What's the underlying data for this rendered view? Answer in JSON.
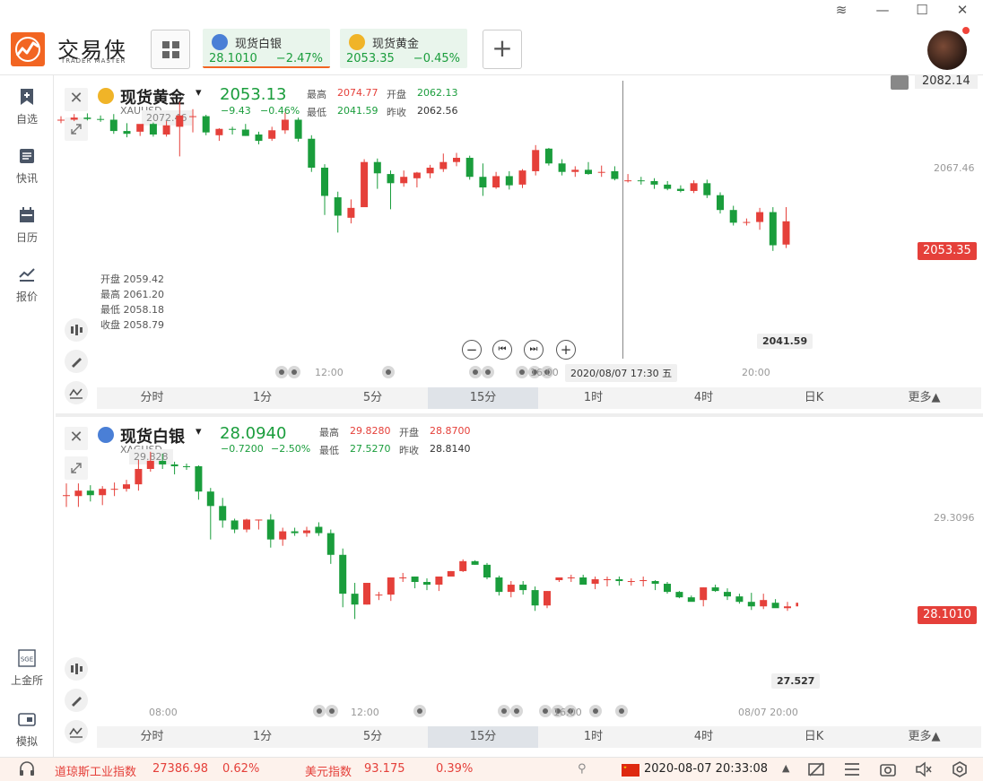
{
  "app": {
    "logo_text": "交易侠",
    "logo_sub": "TRADER MASTER"
  },
  "header_tiles": [
    {
      "name": "现货白银",
      "price": "28.1010",
      "change": "−2.47%",
      "coin_color": "#4a7fd6"
    },
    {
      "name": "现货黄金",
      "price": "2053.35",
      "change": "−0.45%",
      "coin_color": "#f0b428"
    }
  ],
  "sidebar": {
    "items": [
      {
        "label": "自选",
        "icon": "bookmark-plus-icon"
      },
      {
        "label": "快讯",
        "icon": "news-list-icon"
      },
      {
        "label": "日历",
        "icon": "calendar-icon"
      },
      {
        "label": "报价",
        "icon": "quote-chart-icon"
      }
    ],
    "bottom_items": [
      {
        "label": "上金所",
        "icon": "sge-icon",
        "icon_text": "SGE"
      },
      {
        "label": "模拟",
        "icon": "wallet-icon"
      }
    ]
  },
  "gold": {
    "title": "现货黄金",
    "symbol": "XAUUSD",
    "price": "2053.13",
    "change": "−9.43",
    "change_pct": "−0.46%",
    "labels": {
      "high": "最高",
      "open": "开盘",
      "low": "最低",
      "prev": "昨收"
    },
    "high": "2074.77",
    "open": "2062.13",
    "low": "2041.59",
    "prev_close": "2062.56",
    "hover_ohlc": {
      "open": "开盘 2059.42",
      "high": "最高 2061.20",
      "low": "最低 2058.18",
      "close": "收盘 2058.79"
    },
    "max_callout": "2072.46",
    "min_callout": "2041.59",
    "axis_top": "2082.14",
    "axis_mid": "2067.46",
    "current_tag": "2053.35",
    "crosshair_label": "2020/08/07 17:30 五",
    "time_labels": [
      "12:00",
      "16:00",
      "20:00"
    ],
    "zoom_controls": [
      "−",
      "⏮",
      "⏭",
      "+"
    ]
  },
  "silver": {
    "title": "现货白银",
    "symbol": "XAGUSD",
    "price": "28.0940",
    "change": "−0.7200",
    "change_pct": "−2.50%",
    "high": "29.8280",
    "open": "28.8700",
    "low": "27.5270",
    "prev_close": "28.8140",
    "max_callout": "29.828",
    "min_callout": "27.527",
    "axis_mid": "29.3096",
    "current_tag": "28.1010",
    "time_labels": [
      "08:00",
      "12:00",
      "16:00",
      "08/07 20:00"
    ]
  },
  "timeframes": [
    "分时",
    "1分",
    "5分",
    "15分",
    "1时",
    "4时",
    "日K",
    "更多▲"
  ],
  "selected_timeframe": "15分",
  "statusbar": {
    "dow_label": "道琼斯工业指数",
    "dow_value": "27386.98",
    "dow_change": "0.62%",
    "usd_label": "美元指数",
    "usd_value": "93.175",
    "usd_change": "0.39%",
    "datetime": "2020-08-07 20:33:08"
  },
  "colors": {
    "up": "#e5403a",
    "down": "#1a9d3c",
    "accent": "#f26522"
  },
  "chart_data": [
    {
      "type": "candlestick",
      "title": "现货黄金",
      "x": [
        "08/07 ~10:00",
        "...",
        "08/07 ~21:00"
      ],
      "candles_ohlc_approx": [
        [
          2070.0,
          2070.5,
          2069.5,
          2070.0
        ],
        [
          2070.0,
          2070.8,
          2069.8,
          2070.3
        ],
        [
          2070.3,
          2070.9,
          2069.9,
          2070.1
        ],
        [
          2070.1,
          2070.6,
          2069.7,
          2070.0
        ],
        [
          2070.0,
          2070.8,
          2068.0,
          2068.4
        ],
        [
          2068.4,
          2069.5,
          2067.5,
          2068.0
        ],
        [
          2068.3,
          2068.8,
          2067.7,
          2069.4
        ],
        [
          2069.4,
          2069.6,
          2067.6,
          2067.9
        ],
        [
          2067.9,
          2069.8,
          2067.6,
          2069.2
        ],
        [
          2069.0,
          2072.5,
          2064.8,
          2070.6
        ],
        [
          2070.4,
          2071.5,
          2068.2,
          2070.5
        ],
        [
          2070.5,
          2070.7,
          2067.8,
          2068.2
        ],
        [
          2067.8,
          2068.8,
          2067.0,
          2068.7
        ],
        [
          2068.7,
          2069.0,
          2067.9,
          2068.6
        ],
        [
          2068.6,
          2069.4,
          2067.7,
          2067.7
        ],
        [
          2067.9,
          2068.3,
          2066.5,
          2067.0
        ],
        [
          2067.3,
          2069.0,
          2067.0,
          2068.5
        ],
        [
          2068.5,
          2071.0,
          2068.0,
          2070.0
        ],
        [
          2070.0,
          2070.3,
          2066.9,
          2067.3
        ],
        [
          2067.3,
          2067.8,
          2062.6,
          2063.2
        ],
        [
          2063.2,
          2063.7,
          2056.5,
          2059.2
        ],
        [
          2059.0,
          2059.8,
          2054.0,
          2056.4
        ],
        [
          2056.1,
          2058.7,
          2055.3,
          2057.5
        ],
        [
          2057.6,
          2064.4,
          2058.0,
          2064.0
        ],
        [
          2064.0,
          2064.5,
          2060.2,
          2062.4
        ],
        [
          2062.3,
          2062.8,
          2057.3,
          2061.0
        ],
        [
          2061.0,
          2062.8,
          2060.5,
          2061.9
        ],
        [
          2061.7,
          2062.6,
          2060.4,
          2062.5
        ],
        [
          2062.4,
          2063.6,
          2061.7,
          2063.2
        ],
        [
          2063.0,
          2065.2,
          2062.6,
          2064.0
        ],
        [
          2064.0,
          2065.3,
          2063.4,
          2064.6
        ],
        [
          2064.6,
          2064.9,
          2061.5,
          2061.9
        ],
        [
          2061.9,
          2063.8,
          2059.2,
          2060.4
        ],
        [
          2060.4,
          2062.6,
          2060.2,
          2062.0
        ],
        [
          2062.0,
          2062.7,
          2060.1,
          2060.7
        ],
        [
          2060.8,
          2063.0,
          2060.3,
          2062.8
        ],
        [
          2062.7,
          2066.4,
          2062.1,
          2065.7
        ],
        [
          2065.9,
          2066.0,
          2063.5,
          2063.8
        ],
        [
          2063.8,
          2064.4,
          2062.1,
          2062.6
        ],
        [
          2062.6,
          2063.4,
          2061.9,
          2062.9
        ],
        [
          2062.9,
          2064.0,
          2062.2,
          2062.3
        ],
        [
          2062.5,
          2063.5,
          2061.9,
          2062.6
        ],
        [
          2062.7,
          2063.4,
          2061.4,
          2061.6
        ],
        [
          2061.4,
          2062.3,
          2061.1,
          2061.4
        ],
        [
          2061.4,
          2061.9,
          2060.8,
          2061.3
        ],
        [
          2061.3,
          2061.7,
          2060.2,
          2060.8
        ],
        [
          2060.8,
          2061.3,
          2060.0,
          2060.2
        ],
        [
          2060.2,
          2060.7,
          2059.7,
          2059.9
        ],
        [
          2059.9,
          2061.4,
          2059.6,
          2061.0
        ],
        [
          2061.0,
          2061.5,
          2058.9,
          2059.3
        ],
        [
          2059.3,
          2059.7,
          2056.7,
          2057.2
        ],
        [
          2057.2,
          2057.8,
          2055.0,
          2055.4
        ],
        [
          2055.4,
          2056.0,
          2055.0,
          2055.5
        ],
        [
          2055.5,
          2057.5,
          2054.4,
          2056.9
        ],
        [
          2056.9,
          2057.6,
          2051.4,
          2052.2
        ],
        [
          2052.3,
          2057.6,
          2051.8,
          2055.6
        ]
      ],
      "ylim": [
        2041.59,
        2082.14
      ]
    },
    {
      "type": "candlestick",
      "title": "现货白银",
      "x": [
        "08/07 ~07:00",
        "...",
        "08/07 ~21:00"
      ],
      "candles_ohlc_approx": [
        [
          29.3,
          29.44,
          29.18,
          29.31
        ],
        [
          29.3,
          29.44,
          29.18,
          29.36
        ],
        [
          29.36,
          29.42,
          29.24,
          29.31
        ],
        [
          29.31,
          29.41,
          29.2,
          29.38
        ],
        [
          29.38,
          29.45,
          29.3,
          29.38
        ],
        [
          29.38,
          29.48,
          29.35,
          29.43
        ],
        [
          29.43,
          29.7,
          29.36,
          29.6
        ],
        [
          29.6,
          29.79,
          29.57,
          29.69
        ],
        [
          29.69,
          29.77,
          29.6,
          29.65
        ],
        [
          29.65,
          29.68,
          29.54,
          29.63
        ],
        [
          29.63,
          29.66,
          29.59,
          29.62
        ],
        [
          29.63,
          29.64,
          29.26,
          29.35
        ],
        [
          29.35,
          29.39,
          28.82,
          29.19
        ],
        [
          29.19,
          29.28,
          28.95,
          29.03
        ],
        [
          29.03,
          29.05,
          28.89,
          28.93
        ],
        [
          28.93,
          29.05,
          28.9,
          29.04
        ],
        [
          29.03,
          29.04,
          28.93,
          29.04
        ],
        [
          29.04,
          29.1,
          28.73,
          28.82
        ],
        [
          28.82,
          28.95,
          28.75,
          28.91
        ],
        [
          28.91,
          28.95,
          28.86,
          28.89
        ],
        [
          28.89,
          28.96,
          28.85,
          28.92
        ],
        [
          28.96,
          29.01,
          28.86,
          28.89
        ],
        [
          28.89,
          28.93,
          28.55,
          28.65
        ],
        [
          28.65,
          28.72,
          28.07,
          28.22
        ],
        [
          28.22,
          28.34,
          27.94,
          28.1
        ],
        [
          28.1,
          28.34,
          28.1,
          28.34
        ],
        [
          28.2,
          28.24,
          28.15,
          28.21
        ],
        [
          28.21,
          28.4,
          28.14,
          28.4
        ],
        [
          28.4,
          28.45,
          28.35,
          28.4
        ],
        [
          28.41,
          28.41,
          28.28,
          28.35
        ],
        [
          28.35,
          28.39,
          28.26,
          28.32
        ],
        [
          28.32,
          28.41,
          28.25,
          28.41
        ],
        [
          28.41,
          28.47,
          28.44,
          28.47
        ],
        [
          28.47,
          28.6,
          28.46,
          28.58
        ],
        [
          28.58,
          28.59,
          28.54,
          28.54
        ],
        [
          28.54,
          28.56,
          28.38,
          28.4
        ],
        [
          28.4,
          28.42,
          28.2,
          28.24
        ],
        [
          28.24,
          28.36,
          28.18,
          28.32
        ],
        [
          28.32,
          28.36,
          28.21,
          28.26
        ],
        [
          28.26,
          28.3,
          28.03,
          28.09
        ],
        [
          28.09,
          28.25,
          28.06,
          28.25
        ],
        [
          28.37,
          28.4,
          28.35,
          28.4
        ],
        [
          28.4,
          28.43,
          28.35,
          28.4
        ],
        [
          28.4,
          28.43,
          28.35,
          28.32
        ],
        [
          28.33,
          28.41,
          28.27,
          28.38
        ],
        [
          28.38,
          28.41,
          28.3,
          28.38
        ],
        [
          28.38,
          28.41,
          28.31,
          28.36
        ],
        [
          28.36,
          28.39,
          28.31,
          28.36
        ],
        [
          28.36,
          28.41,
          28.3,
          28.37
        ],
        [
          28.36,
          28.37,
          28.26,
          28.33
        ],
        [
          28.33,
          28.35,
          28.22,
          28.24
        ],
        [
          28.24,
          28.25,
          28.17,
          28.18
        ],
        [
          28.18,
          28.2,
          28.14,
          28.13
        ],
        [
          28.15,
          28.29,
          28.08,
          28.29
        ],
        [
          28.29,
          28.32,
          28.24,
          28.25
        ],
        [
          28.24,
          28.28,
          28.15,
          28.19
        ],
        [
          28.19,
          28.22,
          28.11,
          28.13
        ],
        [
          28.13,
          28.23,
          28.04,
          28.08
        ],
        [
          28.08,
          28.22,
          28.05,
          28.15
        ],
        [
          28.12,
          28.16,
          28.07,
          28.06
        ],
        [
          28.06,
          28.13,
          28.03,
          28.08
        ],
        [
          28.08,
          28.15,
          27.527,
          28.12
        ]
      ],
      "ylim": [
        27.527,
        29.828
      ]
    }
  ]
}
